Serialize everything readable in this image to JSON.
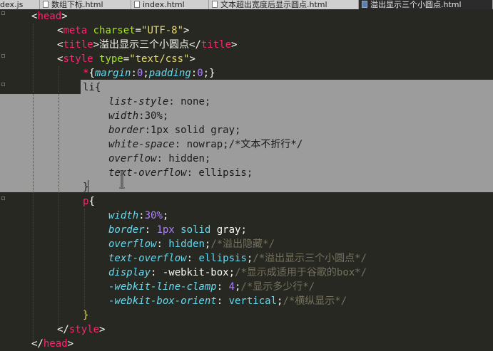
{
  "tabs": [
    {
      "label": "dex.js",
      "active": false
    },
    {
      "label": "数组下标.html",
      "active": false
    },
    {
      "label": "index.html",
      "active": false
    },
    {
      "label": "文本超出宽度后显示圆点.html",
      "active": false
    },
    {
      "label": "溢出显示三个小圆点.html",
      "active": true
    }
  ],
  "code": {
    "l1": {
      "open": "<",
      "tag": "head",
      "close": ">"
    },
    "l2": {
      "open": "<",
      "tag": "meta",
      "attr": " charset",
      "eq": "=",
      "val": "\"UTF-8\"",
      "close": ">"
    },
    "l3": {
      "open": "<",
      "tag": "title",
      "close": ">",
      "text": "溢出显示三个小圆点",
      "endopen": "</",
      "endtag": "title",
      "endclose": ">"
    },
    "l4": {
      "open": "<",
      "tag": "style",
      "attr": " type",
      "eq": "=",
      "val": "\"text/css\"",
      "close": ">"
    },
    "l5": {
      "star": "*",
      "brace": "{",
      "p1": "margin",
      "c1": ":",
      "n1": "0",
      "s1": ";",
      "p2": "padding",
      "c2": ":",
      "n2": "0",
      "s2": ";}"
    },
    "l6": {
      "text": "li{"
    },
    "l7": {
      "prop": "list-style",
      "rest": ": none;"
    },
    "l8": {
      "prop": "width",
      "rest": ":30%;"
    },
    "l9": {
      "prop": "border",
      "rest": ":1px solid gray;"
    },
    "l10": {
      "prop": "white-space",
      "rest": ": nowrap;/*文本不折行*/"
    },
    "l11": {
      "prop": "overflow",
      "rest": ": hidden;"
    },
    "l12": {
      "prop": "text-overflow",
      "rest": ": ellipsis;"
    },
    "l13": {
      "text": "}"
    },
    "l14": {
      "sel": "p",
      "brace": "{"
    },
    "l15": {
      "prop": "width",
      "colon": ":",
      "num": "30%",
      "semi": ";"
    },
    "l16": {
      "prop": "border",
      "colon": ": ",
      "num": "1px",
      "kw": " solid ",
      "val": "gray",
      "semi": ";"
    },
    "l17": {
      "prop": "overflow",
      "colon": ": ",
      "val": "hidden",
      "semi": ";",
      "cmt": "/*溢出隐藏*/"
    },
    "l18": {
      "prop": "text-overflow",
      "colon": ": ",
      "val": "ellipsis",
      "semi": ";",
      "cmt": "/*溢出显示三个小圆点*/"
    },
    "l19": {
      "prop": "display",
      "colon": ": ",
      "val": "-webkit-box",
      "semi": ";",
      "cmt": "/*显示成适用于谷歌的box*/"
    },
    "l20": {
      "prop": "-webkit-line-clamp",
      "colon": ": ",
      "num": "4",
      "semi": ";",
      "cmt": "/*显示多少行*/"
    },
    "l21": {
      "prop": "-webkit-box-orient",
      "colon": ": ",
      "val": "vertical",
      "semi": ";",
      "cmt": "/*横纵显示*/"
    },
    "l22": {
      "text": "}"
    },
    "l23": {
      "endopen": "</",
      "endtag": "style",
      "endclose": ">"
    },
    "l24": {
      "endopen": "</",
      "endtag": "head",
      "endclose": ">"
    }
  },
  "icons": {
    "cursor": "text-cursor-icon",
    "file": "file-icon"
  }
}
